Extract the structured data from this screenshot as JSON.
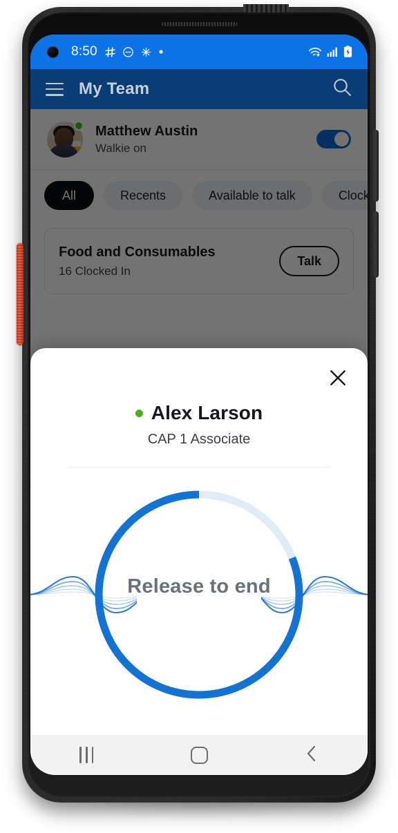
{
  "device": {
    "frame": "android-phone",
    "accent_button_color": "#e2492f"
  },
  "status_bar": {
    "time": "8:50",
    "background": "#0b72e7",
    "left_icons": [
      "slack-icon",
      "do-not-disturb-icon",
      "sparkle-icon",
      "dot-icon"
    ],
    "right_icons": [
      "wifi-icon",
      "cellular-signal-icon",
      "battery-charging-icon"
    ]
  },
  "app_bar": {
    "title": "My Team",
    "background": "#0a3d74",
    "menu_icon": "hamburger-menu-icon",
    "search_icon": "search-icon"
  },
  "my_row": {
    "name": "Matthew Austin",
    "status_text": "Walkie on",
    "presence": "available",
    "presence_color": "#3fbf1f",
    "toggle_on": true,
    "toggle_color": "#0b6ed4"
  },
  "filters": {
    "chips": [
      {
        "label": "All",
        "active": true
      },
      {
        "label": "Recents",
        "active": false
      },
      {
        "label": "Available to talk",
        "active": false
      },
      {
        "label": "Clocked in",
        "active": false
      }
    ]
  },
  "team_cards": [
    {
      "title": "Food and Consumables",
      "subtitle": "16 Clocked In",
      "action_label": "Talk"
    }
  ],
  "sheet": {
    "close_icon": "close-icon",
    "person_name": "Alex Larson",
    "person_role": "CAP 1 Associate",
    "presence": "available",
    "presence_color": "#4caf17",
    "ptt": {
      "label": "Release to end",
      "progress_percent": 81,
      "track_color": "#e2ecf7",
      "arc_color": "#1273d4",
      "label_color": "#6c7176",
      "waveform_color": "#1f74cf"
    }
  },
  "nav_bar": {
    "background": "#f2f2f2",
    "buttons": [
      {
        "name": "recents-button",
        "icon": "recents-icon"
      },
      {
        "name": "home-button",
        "icon": "home-icon"
      },
      {
        "name": "back-button",
        "icon": "back-chevron-icon"
      }
    ]
  }
}
